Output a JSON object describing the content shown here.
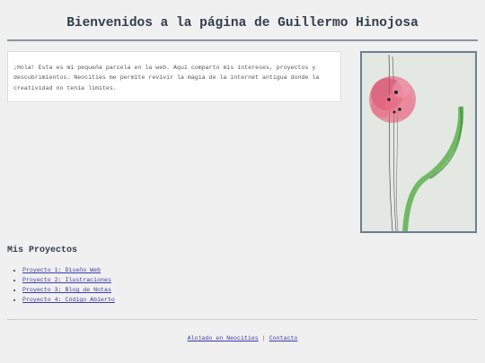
{
  "header": {
    "title": "Bienvenidos a la página de Guillermo Hinojosa"
  },
  "intro": {
    "text": "¡Hola! Esta es mi pequeña parcela en la web. Aquí comparto mis intereses, proyectos y descubrimientos. Neocities me permite revivir la magia de la internet antigua donde la creatividad no tenía límites."
  },
  "artwork": {
    "icon": "flower-painting-image",
    "colors": {
      "petals": "#e0506e",
      "stem": "#4caa3c",
      "frame": "#6d7f8f"
    }
  },
  "projects": {
    "title": "Mis Proyectos",
    "items": [
      {
        "label": "Proyecto 1: Diseño Web"
      },
      {
        "label": "Proyecto 2: Ilustraciones"
      },
      {
        "label": "Proyecto 3: Blog de Notas"
      },
      {
        "label": "Proyecto 4: Código Abierto"
      }
    ]
  },
  "footer": {
    "hosted_label": "Alojado en Neocities",
    "separator": "|",
    "contact_label": "Contacto"
  }
}
